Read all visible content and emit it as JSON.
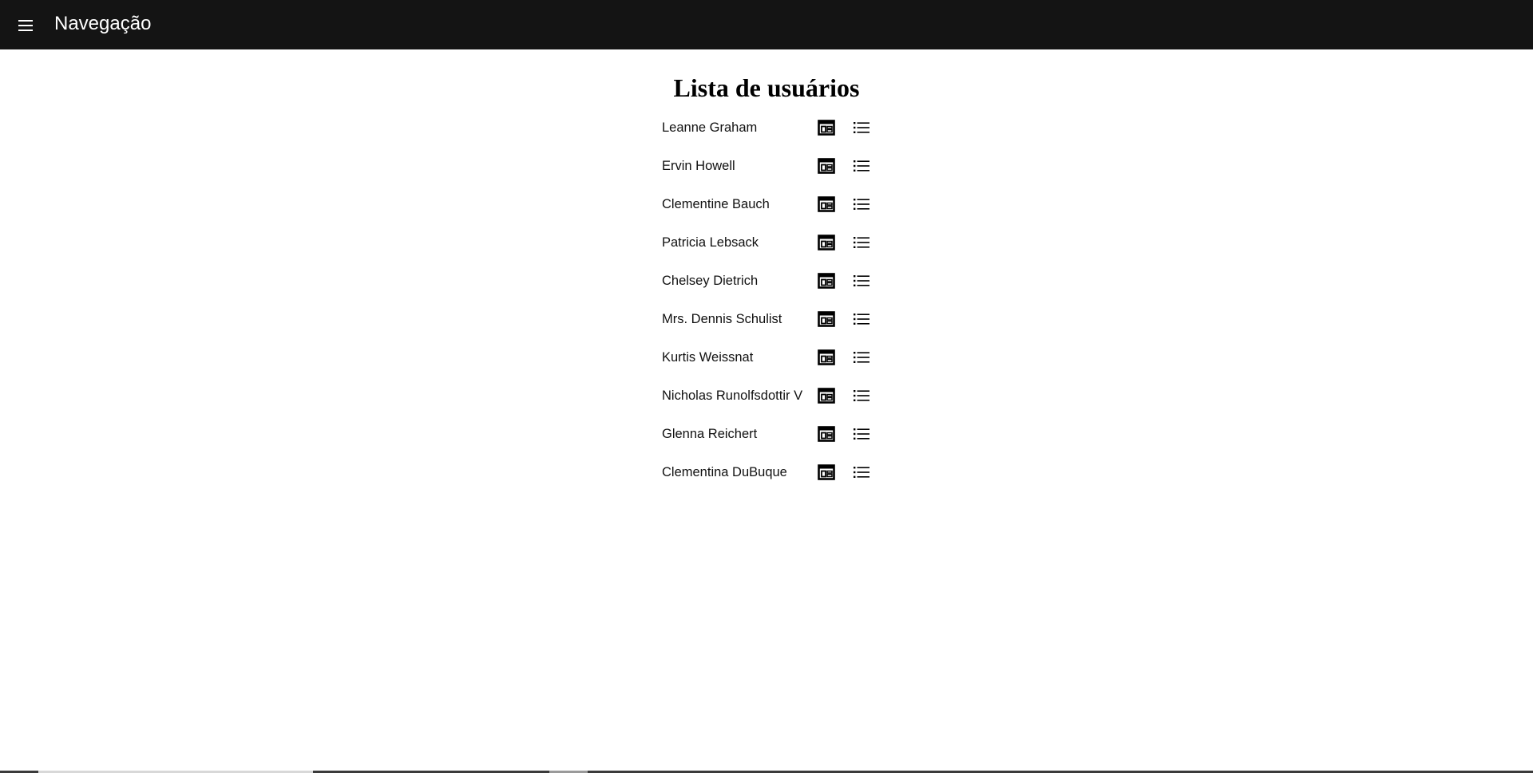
{
  "appbar": {
    "title": "Navegação",
    "menu_icon": "menu-icon"
  },
  "main": {
    "heading": "Lista de usuários",
    "users": [
      {
        "name": "Leanne Graham"
      },
      {
        "name": "Ervin Howell"
      },
      {
        "name": "Clementine Bauch"
      },
      {
        "name": "Patricia Lebsack"
      },
      {
        "name": "Chelsey Dietrich"
      },
      {
        "name": "Mrs. Dennis Schulist"
      },
      {
        "name": "Kurtis Weissnat"
      },
      {
        "name": "Nicholas Runolfsdottir V"
      },
      {
        "name": "Glenna Reichert"
      },
      {
        "name": "Clementina DuBuque"
      }
    ],
    "row_icons": [
      "view-quilt-icon",
      "list-icon"
    ]
  },
  "colors": {
    "appbar_bg": "#141414",
    "appbar_text": "#ffffff",
    "text": "#111111",
    "background": "#ffffff"
  }
}
